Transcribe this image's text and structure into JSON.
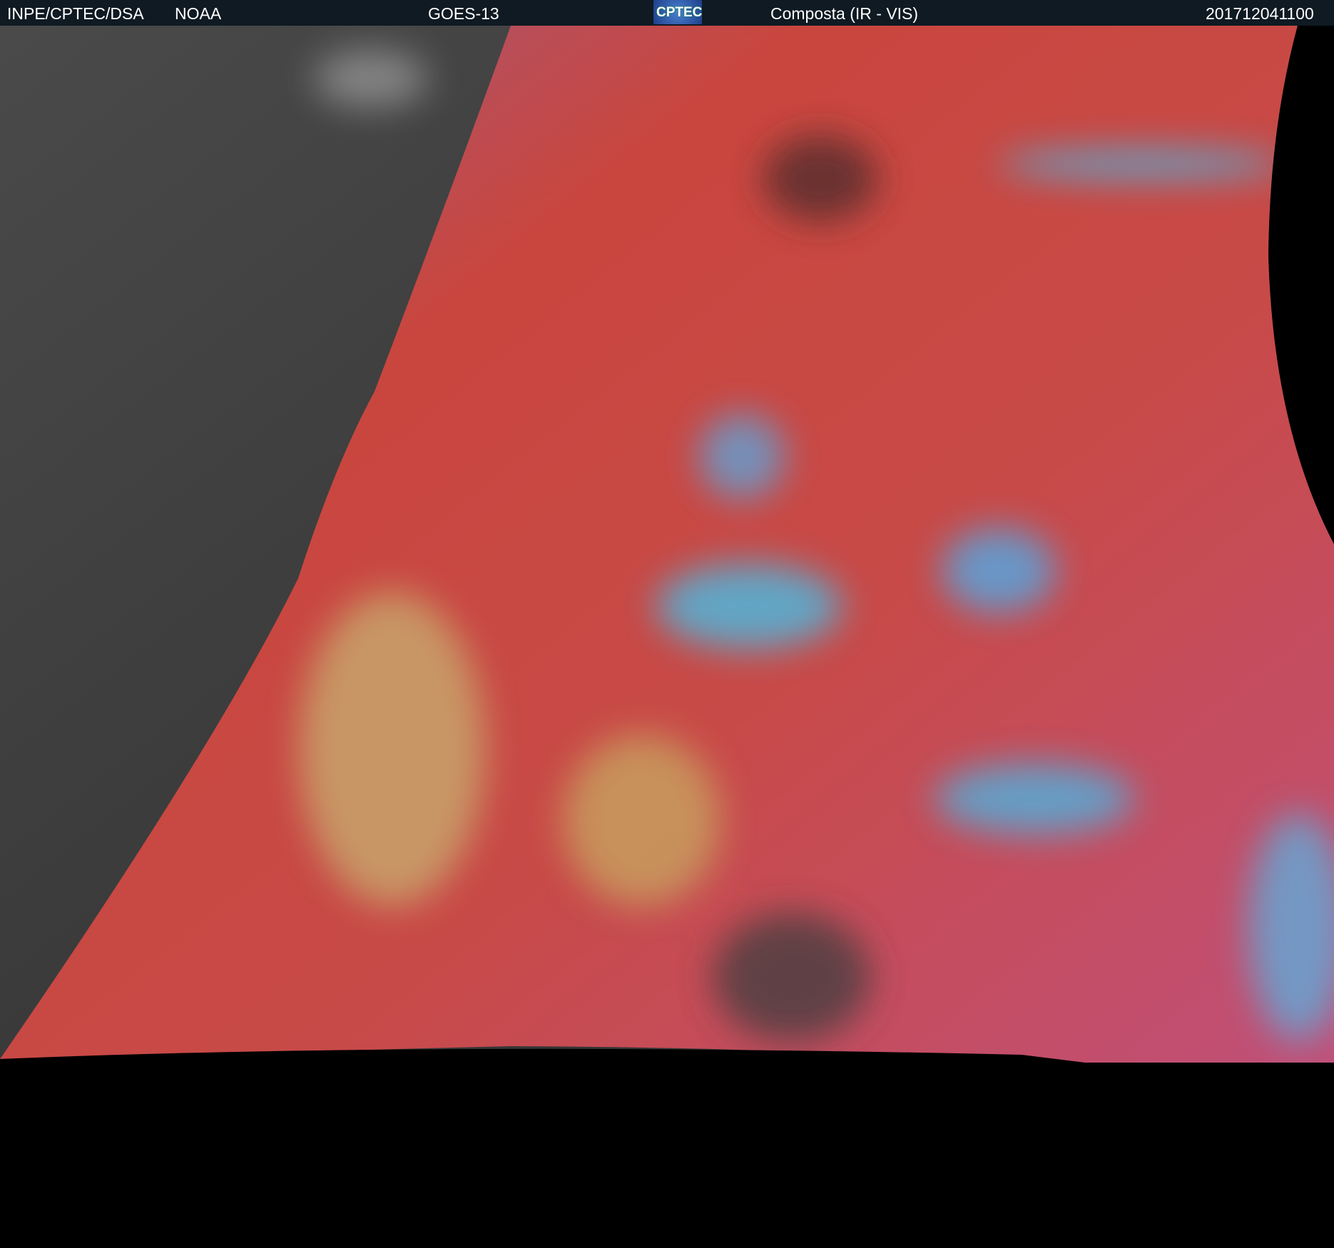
{
  "header": {
    "agency": "INPE/CPTEC/DSA",
    "partner": "NOAA",
    "satellite": "GOES-13",
    "logo_text": "CPTEC",
    "product": "Composta (IR - VIS)",
    "timestamp": "201712041100"
  },
  "colors": {
    "header_bg": "#0f1a22",
    "ocean_ir": "#d84a3e",
    "night_gray": "#3a3a3a",
    "cloud_cyan": "#3fc4f0",
    "background": "#000000"
  }
}
